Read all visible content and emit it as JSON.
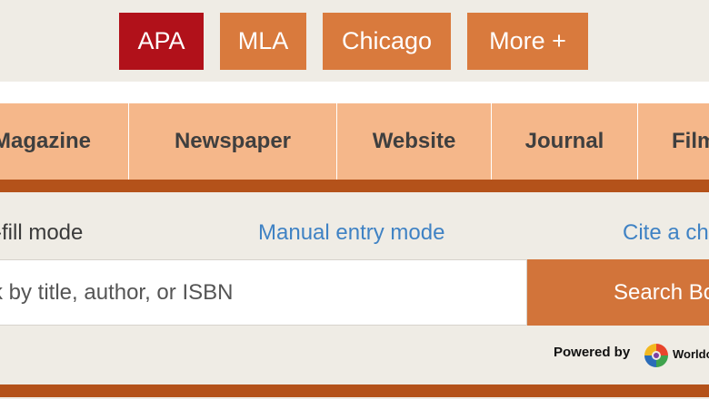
{
  "style_tabs": {
    "apa": "APA",
    "mla": "MLA",
    "chicago": "Chicago",
    "more": "More +",
    "active": "APA"
  },
  "source_tabs": {
    "magazine": "Magazine",
    "newspaper": "Newspaper",
    "website": "Website",
    "journal": "Journal",
    "film": "Film"
  },
  "modes": {
    "autofill": "-fill mode",
    "manual": "Manual entry mode",
    "cite": "Cite a ch"
  },
  "search": {
    "placeholder": "k by title, author, or ISBN",
    "value": "",
    "button_label": "Search Bo"
  },
  "powered_by": {
    "label": "Powered by",
    "brand": "Worldc",
    "brand_icon": "worldcat-logo-icon"
  },
  "colors": {
    "active_tab": "#b1111a",
    "inactive_tab": "#d97a3d",
    "source_tab_bg": "#f5b78a",
    "accent_bar": "#b4521a",
    "link": "#3f82c4",
    "search_button": "#d2743a",
    "page_bg": "#efece5"
  }
}
